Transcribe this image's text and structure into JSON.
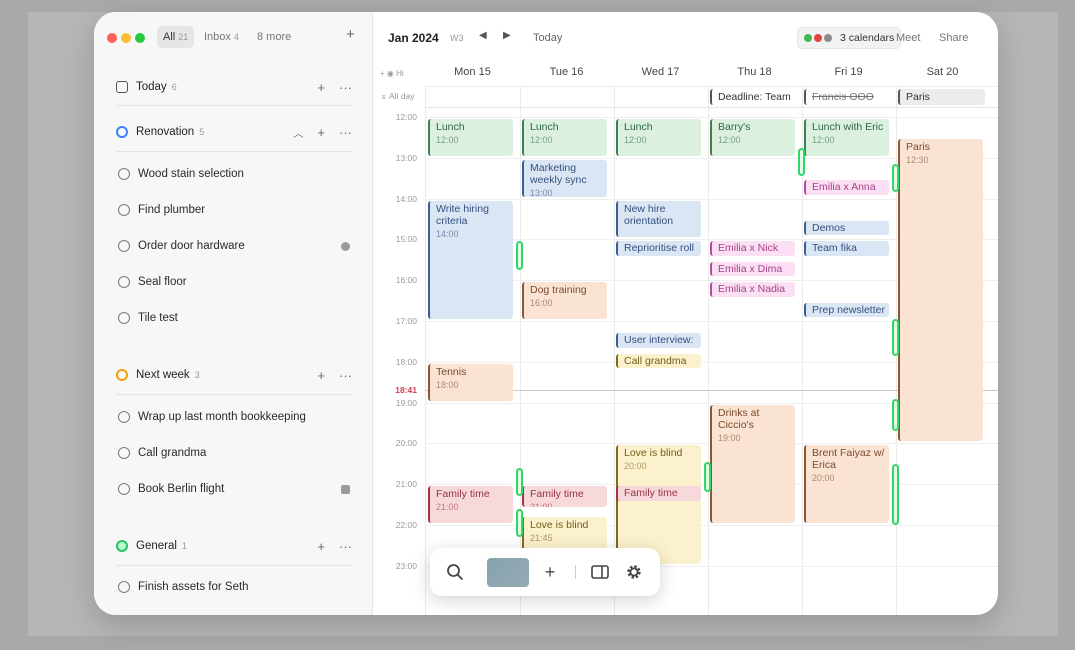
{
  "sidebar": {
    "tabs": [
      {
        "label": "All",
        "count": "21"
      },
      {
        "label": "Inbox",
        "count": "4"
      },
      {
        "label": "8 more",
        "count": ""
      }
    ],
    "add_label": "+",
    "sections": [
      {
        "title": "Today",
        "count": "6",
        "color": "#555555",
        "tasks": []
      },
      {
        "title": "Renovation",
        "count": "5",
        "color": "#3b82f6",
        "tasks": [
          "Wood stain selection",
          "Find plumber",
          "Order door hardware",
          "Seal floor",
          "Tile test"
        ]
      },
      {
        "title": "Next week",
        "count": "3",
        "color": "#f59e0b",
        "tasks": [
          "Wrap up last month bookkeeping",
          "Call grandma",
          "Book Berlin flight"
        ]
      },
      {
        "title": "General",
        "count": "1",
        "color": "#22c55e",
        "tasks": [
          "Finish assets for Seth"
        ]
      }
    ]
  },
  "header": {
    "month": "Jan 2024",
    "week": "W3",
    "today": "Today",
    "calendars": "3 calendars",
    "meet": "Meet",
    "share": "Share",
    "calendar_colors": [
      "#3fb950",
      "#e0443e",
      "#8b8b8b"
    ]
  },
  "grid": {
    "tz_label": "Hi",
    "all_day": "All day",
    "days": [
      "Mon 15",
      "Tue 16",
      "Wed 17",
      "Thu 18",
      "Fri 19",
      "Sat 20"
    ],
    "hours": [
      "12:00",
      "13:00",
      "14:00",
      "15:00",
      "16:00",
      "17:00",
      "18:00",
      "19:00",
      "20:00",
      "21:00",
      "22:00",
      "23:00"
    ],
    "now": "18:41"
  },
  "allday_events": [
    {
      "day": 3,
      "title": "Deadline: Team",
      "strike": false
    },
    {
      "day": 4,
      "title": "Francis OOO",
      "strike": true
    },
    {
      "day": 5,
      "title": "Paris",
      "strike": false
    }
  ],
  "events": [
    {
      "day": 0,
      "title": "Lunch",
      "time": "12:00",
      "start": 12.0,
      "end": 13.0,
      "color": "green"
    },
    {
      "day": 0,
      "title": "Write hiring criteria",
      "time": "14:00",
      "start": 14.0,
      "end": 17.0,
      "color": "blue"
    },
    {
      "day": 0,
      "title": "Tennis",
      "time": "18:00",
      "start": 18.0,
      "end": 19.0,
      "color": "orange"
    },
    {
      "day": 0,
      "title": "Family time",
      "time": "21:00",
      "start": 21.0,
      "end": 22.0,
      "color": "red"
    },
    {
      "day": 1,
      "title": "Lunch",
      "time": "12:00",
      "start": 12.0,
      "end": 13.0,
      "color": "green"
    },
    {
      "day": 1,
      "title": "Marketing weekly sync",
      "time": "13:00",
      "start": 13.0,
      "end": 14.0,
      "color": "blue"
    },
    {
      "day": 1,
      "title": "Dog training",
      "time": "16:00",
      "start": 16.0,
      "end": 17.0,
      "color": "orange"
    },
    {
      "day": 1,
      "title": "Family time",
      "time": "21:00",
      "start": 21.0,
      "end": 21.6,
      "color": "red"
    },
    {
      "day": 1,
      "title": "Love is blind",
      "time": "21:45",
      "start": 21.75,
      "end": 23.0,
      "color": "yellow"
    },
    {
      "day": 2,
      "title": "Lunch",
      "time": "12:00",
      "start": 12.0,
      "end": 13.0,
      "color": "green"
    },
    {
      "day": 2,
      "title": "New hire orientation",
      "time": "",
      "start": 14.0,
      "end": 15.0,
      "color": "blue"
    },
    {
      "day": 2,
      "title": "Reprioritise roll",
      "time": "",
      "start": 15.0,
      "end": 15.45,
      "color": "blue"
    },
    {
      "day": 2,
      "title": "User interview:",
      "time": "",
      "start": 17.25,
      "end": 17.7,
      "color": "blue"
    },
    {
      "day": 2,
      "title": "Call grandma",
      "time": "",
      "start": 17.75,
      "end": 18.2,
      "color": "yellow"
    },
    {
      "day": 2,
      "title": "Love is blind",
      "time": "20:00",
      "start": 20.0,
      "end": 23.0,
      "color": "yellow"
    },
    {
      "day": 2,
      "title": "Family time",
      "time": "",
      "start": 21.0,
      "end": 21.45,
      "color": "red"
    },
    {
      "day": 3,
      "title": "Barry's",
      "time": "12:00",
      "start": 12.0,
      "end": 13.0,
      "color": "green"
    },
    {
      "day": 3,
      "title": "Emilia x Nick",
      "time": "",
      "start": 15.0,
      "end": 15.45,
      "color": "pink"
    },
    {
      "day": 3,
      "title": "Emilia x Dima",
      "time": "",
      "start": 15.5,
      "end": 15.95,
      "color": "pink"
    },
    {
      "day": 3,
      "title": "Emilia x Nadia",
      "time": "",
      "start": 16.0,
      "end": 16.45,
      "color": "pink"
    },
    {
      "day": 3,
      "title": "Drinks at Ciccio's",
      "time": "19:00",
      "start": 19.0,
      "end": 22.0,
      "color": "orange"
    },
    {
      "day": 4,
      "title": "Lunch with Eric",
      "time": "12:00",
      "start": 12.0,
      "end": 13.0,
      "color": "green"
    },
    {
      "day": 4,
      "title": "Emilia x Anna",
      "time": "",
      "start": 13.5,
      "end": 13.95,
      "color": "pink"
    },
    {
      "day": 4,
      "title": "Demos",
      "time": "",
      "start": 14.5,
      "end": 14.95,
      "color": "blue"
    },
    {
      "day": 4,
      "title": "Team fika",
      "time": "",
      "start": 15.0,
      "end": 15.45,
      "color": "blue"
    },
    {
      "day": 4,
      "title": "Prep newsletter",
      "time": "",
      "start": 16.5,
      "end": 16.95,
      "color": "blue"
    },
    {
      "day": 4,
      "title": "Brent Faiyaz w/ Erica",
      "time": "20:00",
      "start": 20.0,
      "end": 22.0,
      "color": "orange"
    },
    {
      "day": 5,
      "title": "Paris",
      "time": "12:30",
      "start": 12.5,
      "end": 20.0,
      "color": "orange"
    }
  ],
  "indicators": [
    {
      "col": 1,
      "start": 15.05,
      "end": 15.75
    },
    {
      "col": 4,
      "start": 12.75,
      "end": 13.45
    },
    {
      "col": 5,
      "start": 13.15,
      "end": 13.85
    },
    {
      "col": 5,
      "start": 16.95,
      "end": 17.85
    },
    {
      "col": 5,
      "start": 18.9,
      "end": 19.7
    },
    {
      "col": 5,
      "start": 20.5,
      "end": 22.0
    },
    {
      "col": 1,
      "start": 20.6,
      "end": 21.3
    },
    {
      "col": 1,
      "start": 21.6,
      "end": 22.3
    },
    {
      "col": 3,
      "start": 20.45,
      "end": 21.2
    }
  ],
  "toolbar": {
    "items": [
      "search-icon",
      "color-swatch",
      "add-icon",
      "panel-icon",
      "settings-icon"
    ],
    "add_label": "+"
  }
}
